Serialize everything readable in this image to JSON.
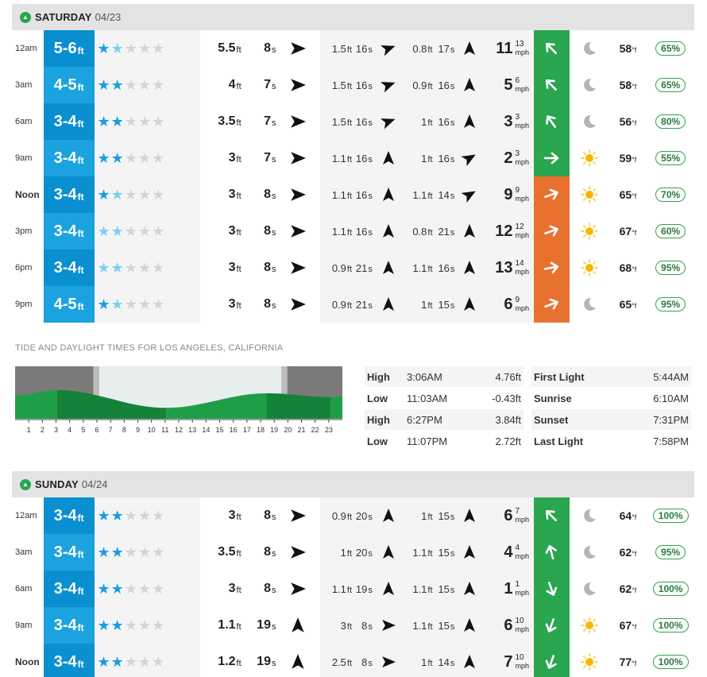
{
  "colors": {
    "surf_blue": "#0a8fd0",
    "surf_blue_light": "#1aa3de",
    "wind_green": "#2aa550",
    "wind_orange": "#e9712f",
    "sun": "#f5b800",
    "moon": "#b5b5b5"
  },
  "days": [
    {
      "name": "SATURDAY",
      "date": "04/23",
      "rows": [
        {
          "time": "12am",
          "surf": "5-6",
          "surf_unit": "ft",
          "stars_on": 1,
          "stars_light": 1,
          "s1h": "5.5",
          "s1p": "8",
          "s1dir": 90,
          "s2h": "1.5",
          "s2p": "16",
          "s2dir": 70,
          "s3h": "0.8",
          "s3p": "17",
          "s3dir": 0,
          "wind": "11",
          "gust": "13",
          "wind_dir": -45,
          "wind_color": "green",
          "wx": "moon",
          "temp": "58",
          "rain": "65%"
        },
        {
          "time": "3am",
          "surf": "4-5",
          "surf_unit": "ft",
          "stars_on": 2,
          "stars_light": 0,
          "s1h": "4",
          "s1p": "7",
          "s1dir": 90,
          "s2h": "1.5",
          "s2p": "16",
          "s2dir": 70,
          "s3h": "0.9",
          "s3p": "16",
          "s3dir": 0,
          "wind": "5",
          "gust": "6",
          "wind_dir": -45,
          "wind_color": "green",
          "wx": "moon",
          "temp": "58",
          "rain": "65%"
        },
        {
          "time": "6am",
          "surf": "3-4",
          "surf_unit": "ft",
          "stars_on": 2,
          "stars_light": 0,
          "s1h": "3.5",
          "s1p": "7",
          "s1dir": 90,
          "s2h": "1.5",
          "s2p": "16",
          "s2dir": 70,
          "s3h": "1",
          "s3p": "16",
          "s3dir": 0,
          "wind": "3",
          "gust": "3",
          "wind_dir": -35,
          "wind_color": "green",
          "wx": "moon",
          "temp": "56",
          "rain": "80%"
        },
        {
          "time": "9am",
          "surf": "3-4",
          "surf_unit": "ft",
          "stars_on": 2,
          "stars_light": 0,
          "s1h": "3",
          "s1p": "7",
          "s1dir": 90,
          "s2h": "1.1",
          "s2p": "16",
          "s2dir": 0,
          "s3h": "1",
          "s3p": "16",
          "s3dir": 60,
          "wind": "2",
          "gust": "3",
          "wind_dir": 90,
          "wind_color": "green",
          "wx": "sun",
          "temp": "59",
          "rain": "55%"
        },
        {
          "time": "Noon",
          "surf": "3-4",
          "surf_unit": "ft",
          "stars_on": 1,
          "stars_light": 1,
          "s1h": "3",
          "s1p": "8",
          "s1dir": 90,
          "s2h": "1.1",
          "s2p": "16",
          "s2dir": 0,
          "s3h": "1.1",
          "s3p": "14",
          "s3dir": 60,
          "wind": "9",
          "gust": "9",
          "wind_dir": 70,
          "wind_color": "orange",
          "wx": "sun",
          "temp": "65",
          "rain": "70%"
        },
        {
          "time": "3pm",
          "surf": "3-4",
          "surf_unit": "ft",
          "stars_on": 0,
          "stars_light": 2,
          "s1h": "3",
          "s1p": "8",
          "s1dir": 90,
          "s2h": "1.1",
          "s2p": "16",
          "s2dir": 0,
          "s3h": "0.8",
          "s3p": "21",
          "s3dir": 0,
          "wind": "12",
          "gust": "12",
          "wind_dir": 70,
          "wind_color": "orange",
          "wx": "sun",
          "temp": "67",
          "rain": "60%"
        },
        {
          "time": "6pm",
          "surf": "3-4",
          "surf_unit": "ft",
          "stars_on": 0,
          "stars_light": 2,
          "s1h": "3",
          "s1p": "8",
          "s1dir": 90,
          "s2h": "0.9",
          "s2p": "21",
          "s2dir": 0,
          "s3h": "1.1",
          "s3p": "16",
          "s3dir": 0,
          "wind": "13",
          "gust": "14",
          "wind_dir": 80,
          "wind_color": "orange",
          "wx": "sun",
          "temp": "68",
          "rain": "95%"
        },
        {
          "time": "9pm",
          "surf": "4-5",
          "surf_unit": "ft",
          "stars_on": 1,
          "stars_light": 1,
          "s1h": "3",
          "s1p": "8",
          "s1dir": 90,
          "s2h": "0.9",
          "s2p": "21",
          "s2dir": 0,
          "s3h": "1",
          "s3p": "15",
          "s3dir": 0,
          "wind": "6",
          "gust": "9",
          "wind_dir": 70,
          "wind_color": "orange",
          "wx": "moon",
          "temp": "65",
          "rain": "95%"
        }
      ]
    },
    {
      "name": "SUNDAY",
      "date": "04/24",
      "rows": [
        {
          "time": "12am",
          "surf": "3-4",
          "surf_unit": "ft",
          "stars_on": 2,
          "stars_light": 0,
          "s1h": "3",
          "s1p": "8",
          "s1dir": 90,
          "s2h": "0.9",
          "s2p": "20",
          "s2dir": 0,
          "s3h": "1",
          "s3p": "15",
          "s3dir": 0,
          "wind": "6",
          "gust": "7",
          "wind_dir": -45,
          "wind_color": "green",
          "wx": "moon",
          "temp": "64",
          "rain": "100%"
        },
        {
          "time": "3am",
          "surf": "3-4",
          "surf_unit": "ft",
          "stars_on": 2,
          "stars_light": 0,
          "s1h": "3.5",
          "s1p": "8",
          "s1dir": 90,
          "s2h": "1",
          "s2p": "20",
          "s2dir": 0,
          "s3h": "1.1",
          "s3p": "15",
          "s3dir": 0,
          "wind": "4",
          "gust": "4",
          "wind_dir": -15,
          "wind_color": "green",
          "wx": "moon",
          "temp": "62",
          "rain": "95%"
        },
        {
          "time": "6am",
          "surf": "3-4",
          "surf_unit": "ft",
          "stars_on": 2,
          "stars_light": 0,
          "s1h": "3",
          "s1p": "8",
          "s1dir": 90,
          "s2h": "1.1",
          "s2p": "19",
          "s2dir": 0,
          "s3h": "1.1",
          "s3p": "15",
          "s3dir": 0,
          "wind": "1",
          "gust": "1",
          "wind_dir": 160,
          "wind_color": "green",
          "wx": "moon",
          "temp": "62",
          "rain": "100%"
        },
        {
          "time": "9am",
          "surf": "3-4",
          "surf_unit": "ft",
          "stars_on": 2,
          "stars_light": 0,
          "s1h": "1.1",
          "s1p": "19",
          "s1dir": 0,
          "s2h": "3",
          "s2p": "8",
          "s2dir": 90,
          "s3h": "1.1",
          "s3p": "15",
          "s3dir": 0,
          "wind": "6",
          "gust": "10",
          "wind_dir": 200,
          "wind_color": "green",
          "wx": "sun",
          "temp": "67",
          "rain": "100%"
        },
        {
          "time": "Noon",
          "surf": "3-4",
          "surf_unit": "ft",
          "stars_on": 2,
          "stars_light": 0,
          "s1h": "1.2",
          "s1p": "19",
          "s1dir": 0,
          "s2h": "2.5",
          "s2p": "8",
          "s2dir": 90,
          "s3h": "1",
          "s3p": "14",
          "s3dir": 0,
          "wind": "7",
          "gust": "10",
          "wind_dir": 200,
          "wind_color": "green",
          "wx": "sun",
          "temp": "77",
          "rain": "100%"
        }
      ]
    }
  ],
  "units": {
    "ft": "ft",
    "s": "s",
    "mph": "mph",
    "deg": "°f"
  },
  "tide": {
    "title": "TIDE AND DAYLIGHT TIMES FOR LOS ANGELES, CALIFORNIA",
    "hour_labels": [
      "1",
      "2",
      "3",
      "4",
      "5",
      "6",
      "7",
      "8",
      "9",
      "10",
      "11",
      "12",
      "13",
      "14",
      "15",
      "16",
      "17",
      "18",
      "19",
      "20",
      "21",
      "22",
      "23"
    ],
    "entries": [
      {
        "type": "High",
        "time": "3:06AM",
        "height": "4.76ft"
      },
      {
        "type": "Low",
        "time": "11:03AM",
        "height": "-0.43ft"
      },
      {
        "type": "High",
        "time": "6:27PM",
        "height": "3.84ft"
      },
      {
        "type": "Low",
        "time": "11:07PM",
        "height": "2.72ft"
      }
    ],
    "daylight": [
      {
        "name": "First Light",
        "time": "5:44AM"
      },
      {
        "name": "Sunrise",
        "time": "6:10AM"
      },
      {
        "name": "Sunset",
        "time": "7:31PM"
      },
      {
        "name": "Last Light",
        "time": "7:58PM"
      }
    ]
  }
}
